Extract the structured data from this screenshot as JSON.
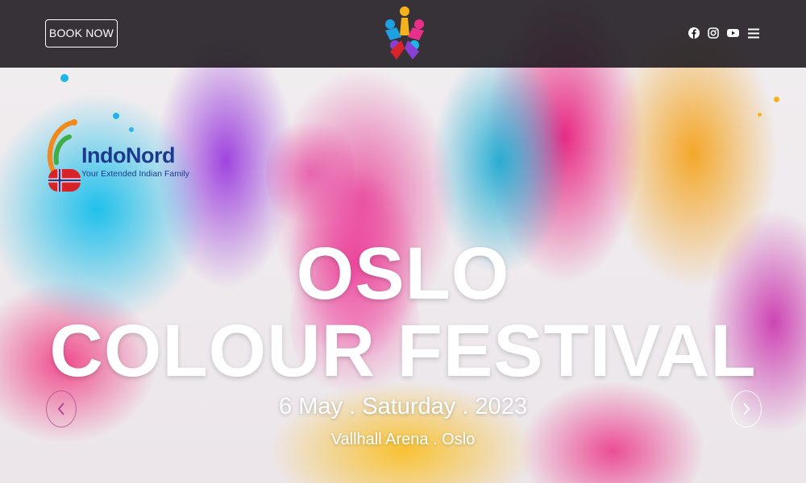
{
  "header": {
    "book_button": "BOOK NOW",
    "center_logo": "colourful-people-logo-icon",
    "social_icons": [
      "facebook-icon",
      "instagram-icon",
      "youtube-icon"
    ],
    "menu_icon": "hamburger-menu-icon"
  },
  "brand": {
    "name": "IndoNord",
    "tagline": "Your Extended Indian Family"
  },
  "hero": {
    "title_line1": "OSLO",
    "title_line2": "COLOUR FESTIVAL",
    "date": "6 May . Saturday . 2023",
    "venue": "Vallhall Arena . Oslo"
  },
  "colors": {
    "nav_bg": "#1c181e",
    "brand_blue": "#1e3a8c",
    "text": "#ffffff"
  }
}
